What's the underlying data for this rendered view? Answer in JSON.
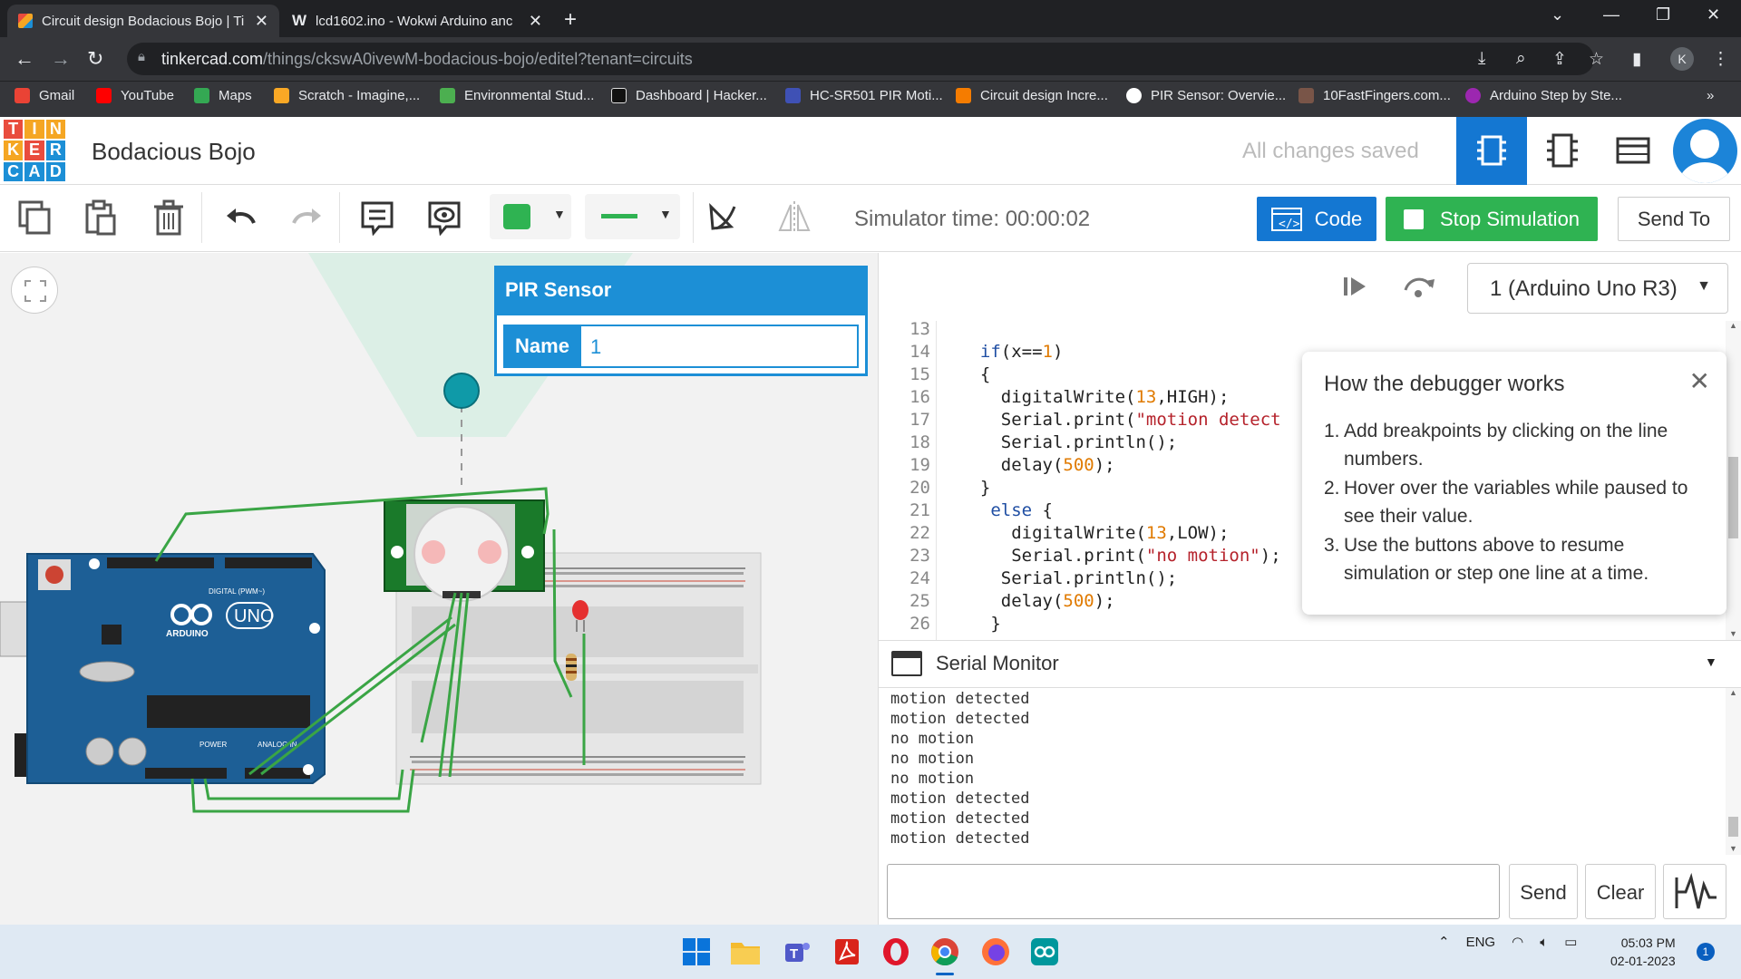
{
  "browser": {
    "tabs": [
      {
        "title": "Circuit design Bodacious Bojo | Ti",
        "active": true
      },
      {
        "title": "lcd1602.ino - Wokwi Arduino anc",
        "active": false
      }
    ],
    "url_host": "tinkercad.com",
    "url_path": "/things/ckswA0ivewM-bodacious-bojo/editel?tenant=circuits",
    "profile_initial": "K",
    "bookmarks": [
      "Gmail",
      "YouTube",
      "Maps",
      "Scratch - Imagine,...",
      "Environmental Stud...",
      "Dashboard | Hacker...",
      "HC-SR501 PIR Moti...",
      "Circuit design Incre...",
      "PIR Sensor: Overvie...",
      "10FastFingers.com...",
      "Arduino Step by Ste..."
    ]
  },
  "app": {
    "logo_letters": [
      "T",
      "I",
      "N",
      "K",
      "E",
      "R",
      "C",
      "A",
      "D"
    ],
    "project_title": "Bodacious Bojo",
    "save_status": "All changes saved"
  },
  "toolbar": {
    "simulator_time": "Simulator time: 00:00:02",
    "code_label": "Code",
    "stop_label": "Stop Simulation",
    "send_to_label": "Send To",
    "fill_color": "#2fb352"
  },
  "inspector": {
    "title": "PIR Sensor",
    "name_label": "Name",
    "name_value": "1"
  },
  "board_labels": {
    "arduino": "ARDUINO",
    "uno": "UNO",
    "power": "POWER",
    "analog": "ANALOG IN",
    "digital": "DIGITAL (PWM~)"
  },
  "code_panel": {
    "device": "1 (Arduino Uno R3)",
    "lines": [
      {
        "n": "13",
        "html": ""
      },
      {
        "n": "14",
        "html": "  <span class='kw'>if</span>(x==<span class='num'>1</span>)"
      },
      {
        "n": "15",
        "html": "  {"
      },
      {
        "n": "16",
        "html": "    digitalWrite(<span class='num'>13</span>,HIGH);"
      },
      {
        "n": "17",
        "html": "    Serial.print(<span class='str'>\"motion detect</span>"
      },
      {
        "n": "18",
        "html": "    Serial.println();"
      },
      {
        "n": "19",
        "html": "    delay(<span class='num'>500</span>);"
      },
      {
        "n": "20",
        "html": "  }"
      },
      {
        "n": "21",
        "html": "   <span class='kw'>else</span> {"
      },
      {
        "n": "22",
        "html": "     digitalWrite(<span class='num'>13</span>,LOW);"
      },
      {
        "n": "23",
        "html": "     Serial.print(<span class='str'>\"no motion\"</span>);"
      },
      {
        "n": "24",
        "html": "    Serial.println();"
      },
      {
        "n": "25",
        "html": "    delay(<span class='num'>500</span>);"
      },
      {
        "n": "26",
        "html": "   }"
      }
    ]
  },
  "debugger_tip": {
    "title": "How the debugger works",
    "items": [
      "Add breakpoints by clicking on the line numbers.",
      "Hover over the variables while paused to see their value.",
      "Use the buttons above to resume simulation or step one line at a time."
    ]
  },
  "serial_monitor": {
    "title": "Serial Monitor",
    "output": [
      "motion detected",
      "motion detected",
      "no motion",
      "no motion",
      "no motion",
      "motion detected",
      "motion detected",
      "motion detected"
    ],
    "input_value": "",
    "send_label": "Send",
    "clear_label": "Clear"
  },
  "taskbar": {
    "language": "ENG",
    "time": "05:03 PM",
    "date": "02-01-2023",
    "notifications": "1"
  }
}
